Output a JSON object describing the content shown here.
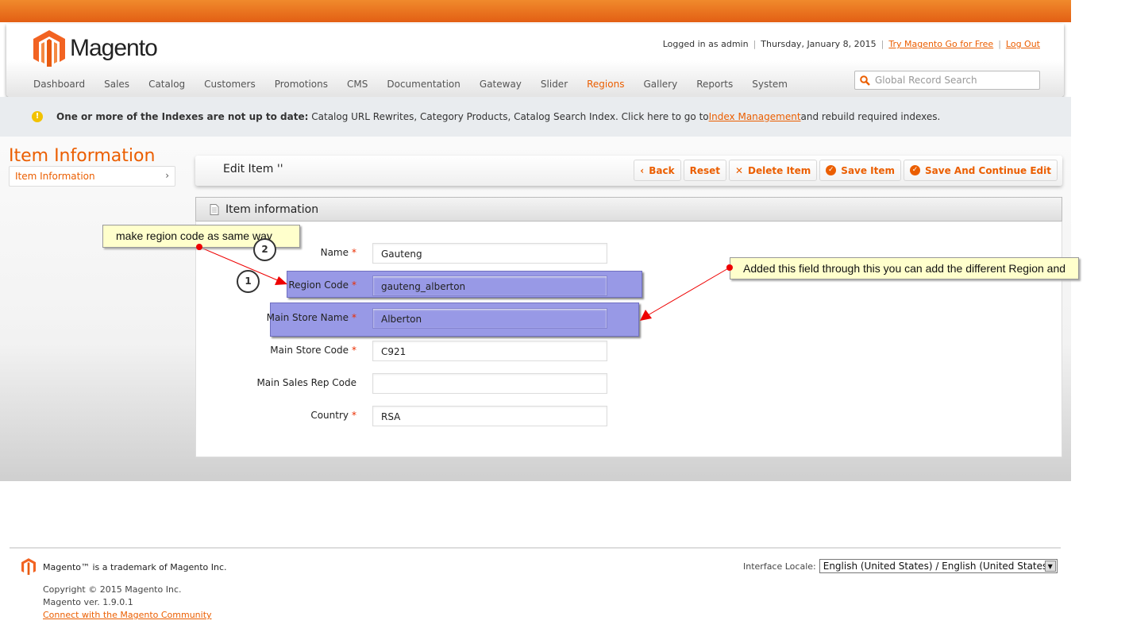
{
  "header": {
    "logo": "Magento",
    "logged_in": "Logged in as admin",
    "date": "Thursday, January 8, 2015",
    "try_link": "Try Magento Go for Free",
    "logout": "Log Out",
    "search_placeholder": "Global Record Search",
    "nav": [
      "Dashboard",
      "Sales",
      "Catalog",
      "Customers",
      "Promotions",
      "CMS",
      "Documentation",
      "Gateway",
      "Slider",
      "Regions",
      "Gallery",
      "Reports",
      "System"
    ],
    "active_nav": "Regions"
  },
  "notice": {
    "bold": "One or more of the Indexes are not up to date:",
    "text": " Catalog URL Rewrites, Category Products, Catalog Search Index. Click here to go to ",
    "link": "Index Management",
    "tail": " and rebuild required indexes."
  },
  "sidebar": {
    "title": "Item Information",
    "item": "Item Information"
  },
  "edit": {
    "title": "Edit Item ''",
    "buttons": {
      "back": "Back",
      "reset": "Reset",
      "delete": "Delete Item",
      "save": "Save Item",
      "save_continue": "Save And Continue Edit"
    }
  },
  "section": {
    "title": "Item information"
  },
  "form": {
    "fields": [
      {
        "label": "Name",
        "value": "Gauteng",
        "required": true
      },
      {
        "label": "Region Code",
        "value": "gauteng_alberton",
        "required": true
      },
      {
        "label": "Main Store Name",
        "value": "Alberton",
        "required": true
      },
      {
        "label": "Main Store Code",
        "value": "C921",
        "required": true
      },
      {
        "label": "Main Sales Rep Code",
        "value": "",
        "required": false
      },
      {
        "label": "Country",
        "value": "RSA",
        "required": true
      }
    ]
  },
  "annotations": {
    "callout1": "make region code as same way",
    "callout2": "Added this field through this you can add the different Region and",
    "step1": "1",
    "step2": "2"
  },
  "footer": {
    "trademark": "Magento™ is a trademark of Magento Inc.",
    "copyright": "Copyright © 2015 Magento Inc.",
    "version": "Magento ver. 1.9.0.1",
    "community": "Connect with the Magento Community",
    "locale_label": "Interface Locale:",
    "locale_value": "English (United States) / English (United States)"
  },
  "colors": {
    "accent": "#eb5e00",
    "highlight": "#9899e6"
  }
}
